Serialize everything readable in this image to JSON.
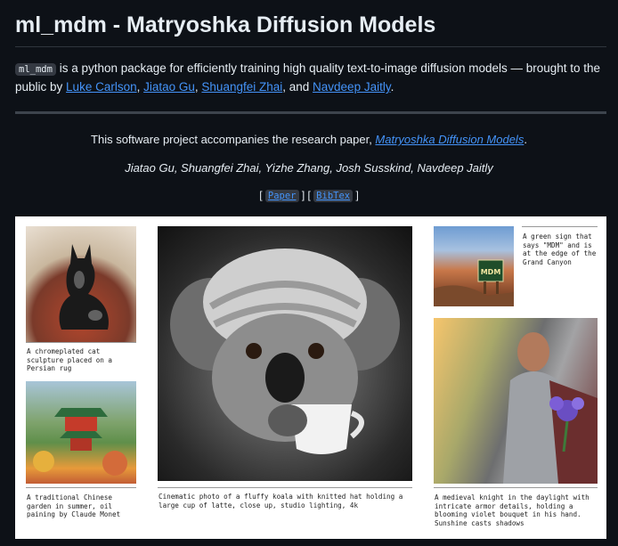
{
  "header": {
    "title": "ml_mdm - Matryoshka Diffusion Models"
  },
  "intro": {
    "package": "ml_mdm",
    "text_before": " is a python package for efficiently training high quality text-to-image diffusion models — brought to the public by ",
    "authors": [
      "Luke Carlson",
      "Jiatao Gu",
      "Shuangfei Zhai",
      "Navdeep Jaitly"
    ],
    "sep1": ", ",
    "sep2": ", ",
    "sep3": ", and ",
    "end": "."
  },
  "paper": {
    "lead": "This software project accompanies the research paper, ",
    "link": "Matryoshka Diffusion Models",
    "end": ".",
    "authors_line": "Jiatao Gu, Shuangfei Zhai, Yizhe Zhang, Josh Susskind, Navdeep Jaitly",
    "bracket_open": "[ ",
    "paper_link": "Paper",
    "mid": " ] [ ",
    "bibtex_link": "BibTex",
    "bracket_close": " ]"
  },
  "gallery": {
    "captions": {
      "cat": "A chromeplated cat sculpture placed on a Persian rug",
      "garden": "A traditional Chinese garden in summer, oil paining by Claude Monet",
      "koala": "Cinematic photo of a fluffy koala with knitted hat holding a large cup of latte, close up, studio lighting, 4k",
      "canyon": "A green sign that says \"MDM\" and is at the edge of the Grand Canyon",
      "knight": "A medieval knight in the daylight with intricate armor details, holding a blooming violet bouquet in his hand. Sunshine casts shadows"
    },
    "sign_text": "MDM"
  }
}
